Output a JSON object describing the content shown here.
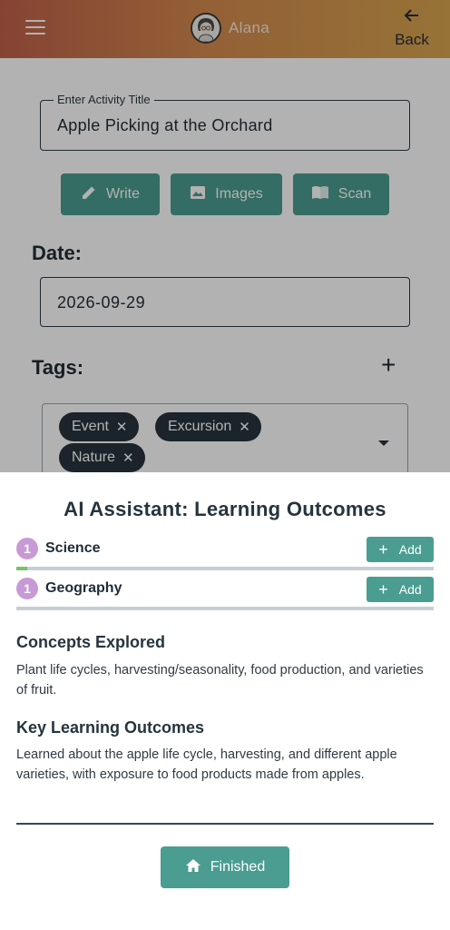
{
  "header": {
    "username": "Alana",
    "back_label": "Back",
    "colors": {
      "gradient_start": "#c0614a",
      "gradient_end": "#d8a54f"
    }
  },
  "form": {
    "title_legend": "Enter Activity Title",
    "title_value": "Apple Picking at the Orchard",
    "actions": [
      {
        "label": "Write",
        "icon": "pencil-icon"
      },
      {
        "label": "Images",
        "icon": "image-icon"
      },
      {
        "label": "Scan",
        "icon": "book-icon"
      }
    ],
    "date_label": "Date:",
    "date_value": "2026-09-29",
    "tags_label": "Tags:",
    "tags": [
      "Event",
      "Excursion",
      "Nature"
    ]
  },
  "sheet": {
    "title": "AI Assistant: Learning Outcomes",
    "subjects": [
      {
        "count": "1",
        "name": "Science",
        "add_label": "Add",
        "progress": 0.025
      },
      {
        "count": "1",
        "name": "Geography",
        "add_label": "Add",
        "progress": 0
      }
    ],
    "concepts_heading": "Concepts Explored",
    "concepts_text": "Plant life cycles, harvesting/seasonality, food production, and varieties of fruit.",
    "outcomes_heading": "Key Learning Outcomes",
    "outcomes_text": "Learned about the apple life cycle, harvesting, and different apple varieties, with exposure to food products made from apples.",
    "finished_label": "Finished",
    "accent_color": "#4a9d90",
    "badge_color": "#c79ad6"
  }
}
